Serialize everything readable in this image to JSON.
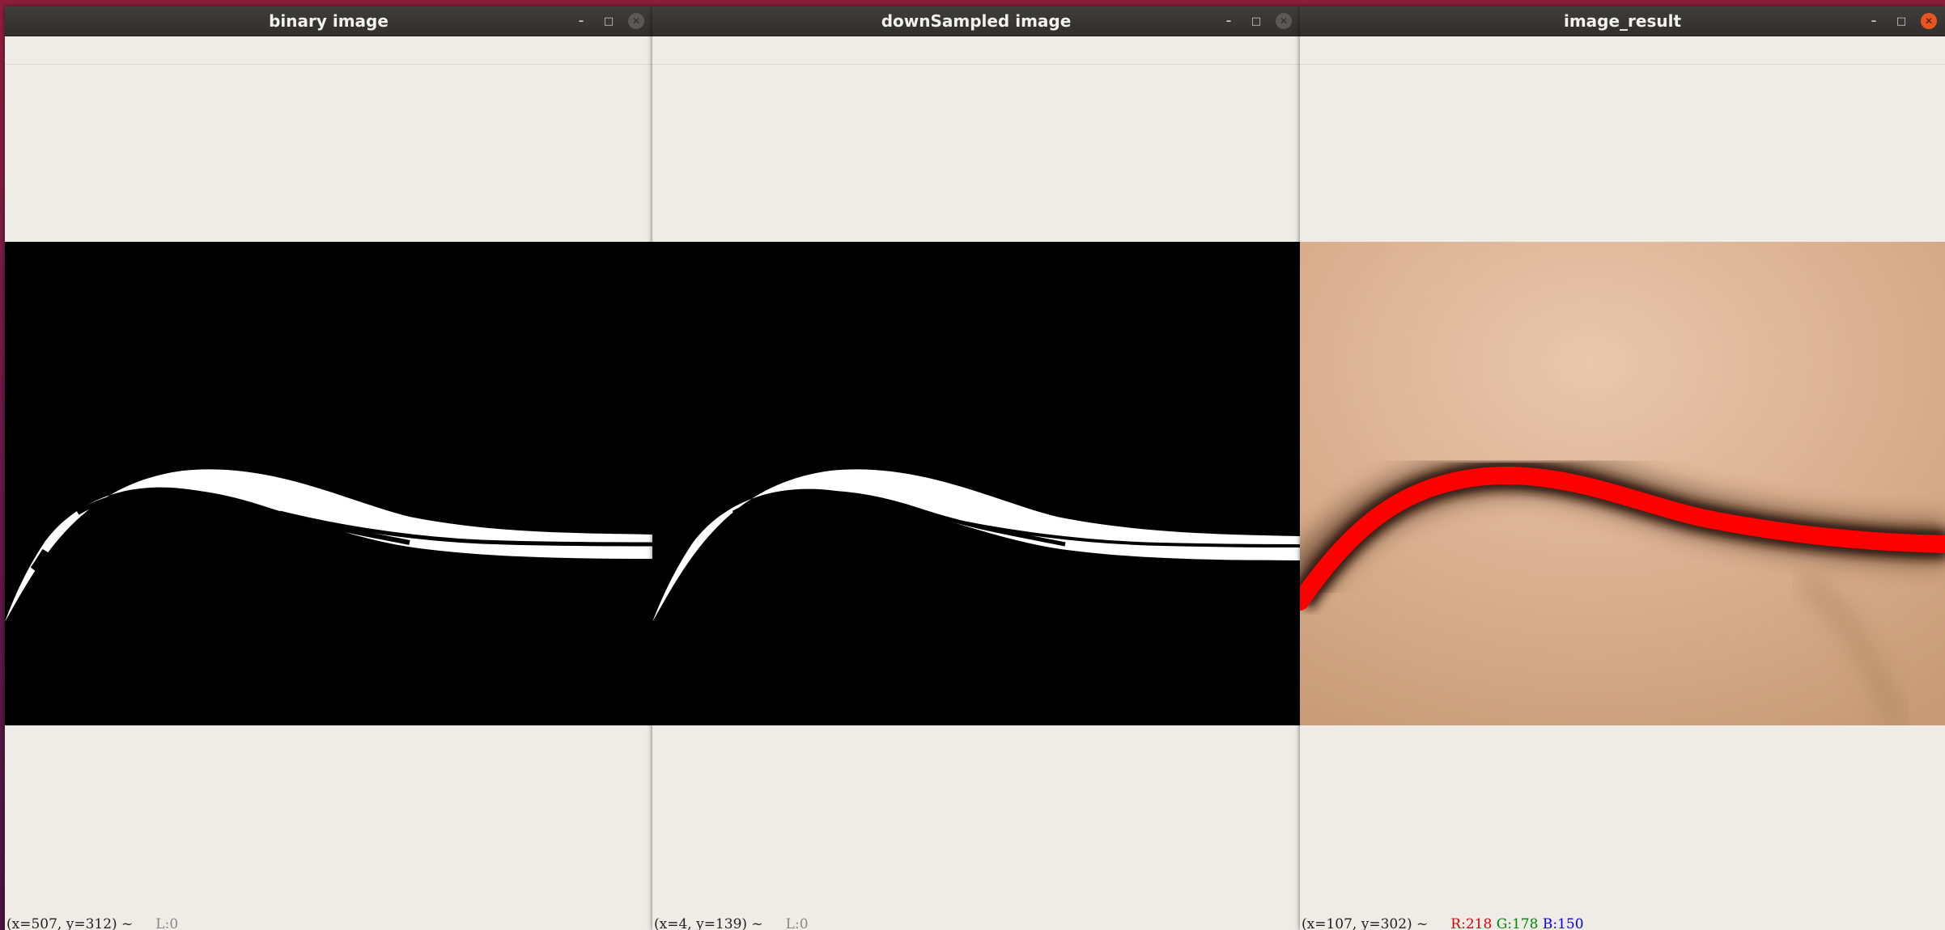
{
  "windows": [
    {
      "title": "binary image",
      "status": {
        "coords": "(x=507, y=312) ~",
        "value": "L:0"
      },
      "controls": {
        "minimize": "–",
        "maximize": "□",
        "close": "✕"
      }
    },
    {
      "title": "downSampled image",
      "status": {
        "coords": "(x=4, y=139) ~",
        "value": "L:0"
      },
      "controls": {
        "minimize": "–",
        "maximize": "□",
        "close": "✕"
      }
    },
    {
      "title": "image_result",
      "status": {
        "coords": "(x=107, y=302) ~",
        "r": "R:218",
        "g": "G:178",
        "b": "B:150"
      },
      "controls": {
        "minimize": "–",
        "maximize": "□",
        "close": "✕"
      }
    }
  ],
  "colors": {
    "titlebar": "#353431",
    "background": "#efebe6",
    "close_active": "#e9541f",
    "result_line": "#ff0000",
    "skin": "#d6ab8a"
  },
  "icons": [
    "minimize-icon",
    "maximize-icon",
    "close-icon"
  ]
}
